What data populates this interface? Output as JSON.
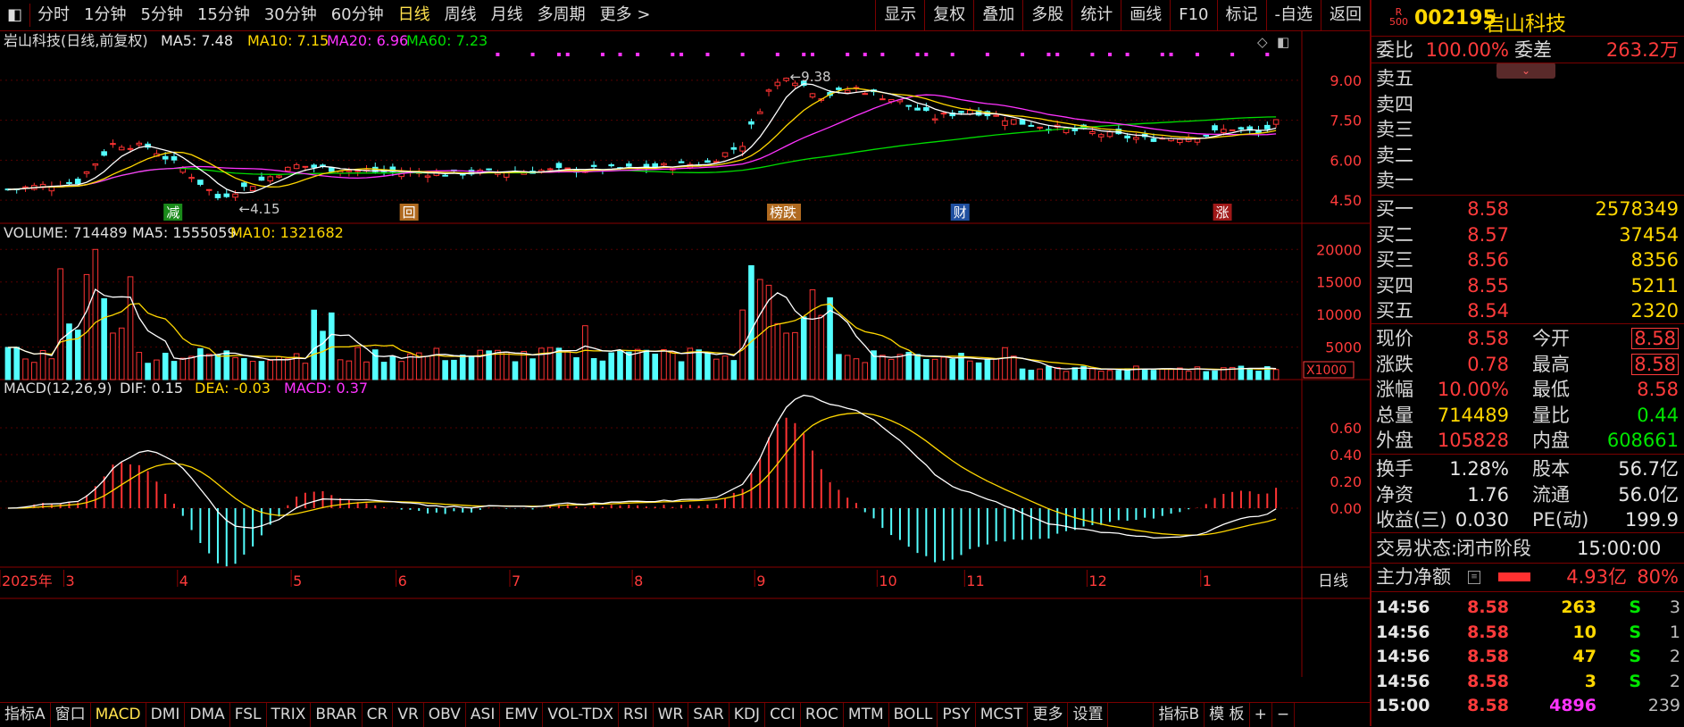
{
  "toolbar": {
    "left": [
      "分时",
      "1分钟",
      "5分钟",
      "15分钟",
      "30分钟",
      "60分钟",
      "日线",
      "周线",
      "月线",
      "多周期",
      "更多 >"
    ],
    "active": "日线",
    "right": [
      "显示",
      "复权",
      "叠加",
      "多股",
      "统计",
      "画线",
      "F10",
      "标记",
      "-自选",
      "返回"
    ]
  },
  "kline": {
    "title": "岩山科技(日线,前复权)",
    "ma5": "MA5: 7.48",
    "ma10": "MA10: 7.15",
    "ma20": "MA20: 6.96",
    "ma60": "MA60: 7.23",
    "high_label": "9.38",
    "low_label": "4.15",
    "yticks": [
      "9.00",
      "7.50",
      "6.00",
      "4.50"
    ],
    "yvals": [
      9.0,
      7.5,
      6.0,
      4.5
    ],
    "ylim": [
      3.9,
      10.1
    ],
    "markers": [
      {
        "t": "减",
        "c": "#1a8a1a",
        "i": 18
      },
      {
        "t": "回",
        "c": "#b06a20",
        "i": 45
      },
      {
        "t": "榜跌",
        "c": "#b06a20",
        "i": 87
      },
      {
        "t": "财",
        "c": "#2050a0",
        "i": 108
      },
      {
        "t": "涨",
        "c": "#a01818",
        "i": 138
      }
    ],
    "colors": {
      "up": "#ff3333",
      "down": "#54ffff",
      "ma5": "#ffffff",
      "ma10": "#ffd700",
      "ma20": "#ff33ff",
      "ma60": "#00dd00"
    }
  },
  "volume": {
    "title": "VOLUME: 714489",
    "ma5": "MA5: 1555059",
    "ma10": "MA10: 1321682",
    "yticks": [
      "20000",
      "15000",
      "10000",
      "5000"
    ],
    "yvals": [
      20000,
      15000,
      10000,
      5000
    ],
    "ymax": 21000,
    "unit": "X1000"
  },
  "macd": {
    "title": "MACD(12,26,9)",
    "dif": "DIF: 0.15",
    "dea": "DEA: -0.03",
    "macd": "MACD: 0.37",
    "yticks": [
      "0.60",
      "0.40",
      "0.20",
      "0.00"
    ],
    "yvals": [
      0.6,
      0.4,
      0.2,
      0.0
    ],
    "ylim": [
      -0.4,
      0.8
    ]
  },
  "xaxis": {
    "labels": [
      {
        "t": "2025年",
        "i": 0
      },
      {
        "t": "3",
        "i": 7
      },
      {
        "t": "4",
        "i": 20
      },
      {
        "t": "5",
        "i": 33
      },
      {
        "t": "6",
        "i": 45
      },
      {
        "t": "7",
        "i": 58
      },
      {
        "t": "8",
        "i": 72
      },
      {
        "t": "9",
        "i": 86
      },
      {
        "t": "10",
        "i": 100
      },
      {
        "t": "11",
        "i": 110
      },
      {
        "t": "12",
        "i": 124
      },
      {
        "t": "1",
        "i": 137
      }
    ],
    "period": "日线"
  },
  "bottom_tabs": [
    "指标A",
    "窗口",
    "MACD",
    "DMI",
    "DMA",
    "FSL",
    "TRIX",
    "BRAR",
    "CR",
    "VR",
    "OBV",
    "ASI",
    "EMV",
    "VOL-TDX",
    "RSI",
    "WR",
    "SAR",
    "KDJ",
    "CCI",
    "ROC",
    "MTM",
    "BOLL",
    "PSY",
    "MCST",
    "更多",
    "设置",
    "",
    "指标B",
    "模 板",
    "+",
    "−"
  ],
  "bottom_active": "MACD",
  "stock": {
    "code": "002195",
    "name": "岩山科技",
    "badge_top": "R",
    "badge_bot": "500"
  },
  "weibi": {
    "label1": "委比",
    "val1": "100.00%",
    "label2": "委差",
    "val2": "263.2万"
  },
  "sell": [
    {
      "l": "卖五"
    },
    {
      "l": "卖四"
    },
    {
      "l": "卖三"
    },
    {
      "l": "卖二"
    },
    {
      "l": "卖一"
    }
  ],
  "buy": [
    {
      "l": "买一",
      "p": "8.58",
      "v": "2578349"
    },
    {
      "l": "买二",
      "p": "8.57",
      "v": "37454"
    },
    {
      "l": "买三",
      "p": "8.56",
      "v": "8356"
    },
    {
      "l": "买四",
      "p": "8.55",
      "v": "5211"
    },
    {
      "l": "买五",
      "p": "8.54",
      "v": "2320"
    }
  ],
  "quote": [
    {
      "l1": "现价",
      "v1": "8.58",
      "c1": "red",
      "l2": "今开",
      "v2": "8.58",
      "c2": "red",
      "box": true
    },
    {
      "l1": "涨跌",
      "v1": "0.78",
      "c1": "red",
      "l2": "最高",
      "v2": "8.58",
      "c2": "red",
      "box": true
    },
    {
      "l1": "涨幅",
      "v1": "10.00%",
      "c1": "red",
      "l2": "最低",
      "v2": "8.58",
      "c2": "red"
    },
    {
      "l1": "总量",
      "v1": "714489",
      "c1": "yel",
      "l2": "量比",
      "v2": "0.44",
      "c2": "grn"
    },
    {
      "l1": "外盘",
      "v1": "105828",
      "c1": "red",
      "l2": "内盘",
      "v2": "608661",
      "c2": "grn"
    }
  ],
  "fund": [
    {
      "l1": "换手",
      "v1": "1.28%",
      "l2": "股本",
      "v2": "56.7亿"
    },
    {
      "l1": "净资",
      "v1": "1.76",
      "l2": "流通",
      "v2": "56.0亿"
    },
    {
      "l1": "收益(三)",
      "v1": "0.030",
      "l2": "PE(动)",
      "v2": "199.9"
    }
  ],
  "status": {
    "label": "交易状态:",
    "value": "闭市阶段",
    "time": "15:00:00"
  },
  "mainflow": {
    "label": "主力净额",
    "value": "4.93亿",
    "pct": "80%"
  },
  "ticks": [
    {
      "t": "14:56",
      "p": "8.58",
      "v": "263",
      "s": "S",
      "n": "3"
    },
    {
      "t": "14:56",
      "p": "8.58",
      "v": "10",
      "s": "S",
      "n": "1"
    },
    {
      "t": "14:56",
      "p": "8.58",
      "v": "47",
      "s": "S",
      "n": "2"
    },
    {
      "t": "14:56",
      "p": "8.58",
      "v": "3",
      "s": "S",
      "n": "2"
    },
    {
      "t": "15:00",
      "p": "8.58",
      "v": "4896",
      "s": "",
      "n": "239"
    }
  ]
}
